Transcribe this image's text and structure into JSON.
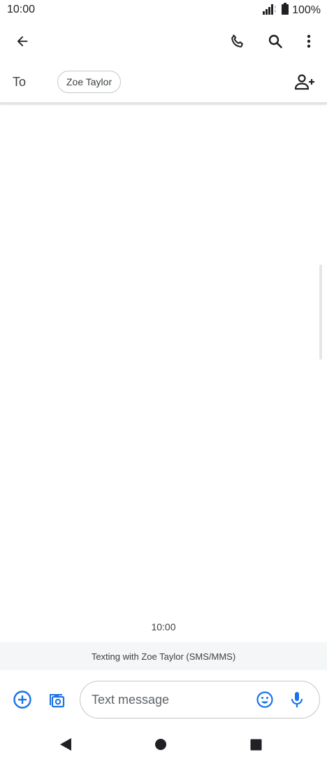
{
  "status_bar": {
    "time": "10:00",
    "battery": "100%",
    "icons": [
      "signal-icon",
      "battery-icon"
    ]
  },
  "app_bar": {
    "icons": [
      "back-arrow-icon",
      "phone-icon",
      "search-icon",
      "more-vert-icon"
    ]
  },
  "recipients": {
    "to_label": "To",
    "contact_chip": "Zoe Taylor",
    "add_icon": "add-person-icon"
  },
  "conversation": {
    "timestamp": "10:00",
    "banner": "Texting with Zoe Taylor (SMS/MMS)"
  },
  "compose": {
    "placeholder": "Text message",
    "icons": [
      "add-circle-icon",
      "gallery-icon",
      "emoji-icon",
      "mic-icon"
    ]
  },
  "nav_bar": {
    "icons": [
      "back-triangle-icon",
      "home-circle-icon",
      "recents-square-icon"
    ]
  },
  "colors": {
    "accent": "#1a73e8",
    "icon": "#202124",
    "banner_bg": "#f5f6f7"
  }
}
